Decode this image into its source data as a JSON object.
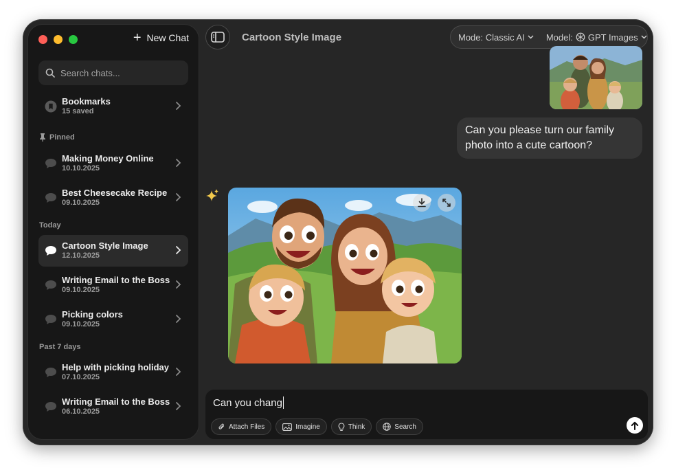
{
  "window": {
    "title": "Cartoon Style Image"
  },
  "sidebar": {
    "new_chat": "New Chat",
    "search_placeholder": "Search chats...",
    "bookmarks": {
      "label": "Bookmarks",
      "sub": "15 saved"
    },
    "pinned_label": "Pinned",
    "pinned": [
      {
        "label": "Making Money Online",
        "date": "10.10.2025"
      },
      {
        "label": "Best Cheesecake Recipe",
        "date": "09.10.2025"
      }
    ],
    "today_label": "Today",
    "today": [
      {
        "label": "Cartoon Style Image",
        "date": "12.10.2025"
      },
      {
        "label": "Writing Email to the Boss",
        "date": "09.10.2025"
      },
      {
        "label": "Picking colors",
        "date": "09.10.2025"
      }
    ],
    "past_label": "Past 7 days",
    "past": [
      {
        "label": "Help with picking holiday",
        "date": "07.10.2025"
      },
      {
        "label": "Writing Email to the Boss",
        "date": "06.10.2025"
      }
    ]
  },
  "header": {
    "mode_label": "Mode: Classic AI",
    "model_label": "Model:",
    "model_value": "GPT Images"
  },
  "chat": {
    "user_message": "Can you please turn our family photo into a cute cartoon?"
  },
  "composer": {
    "value": "Can you chang",
    "tools": [
      "Attach Files",
      "Imagine",
      "Think",
      "Search"
    ]
  },
  "colors": {
    "bg": "#262626",
    "sidebar": "#171717",
    "accent_white": "#ffffff"
  }
}
